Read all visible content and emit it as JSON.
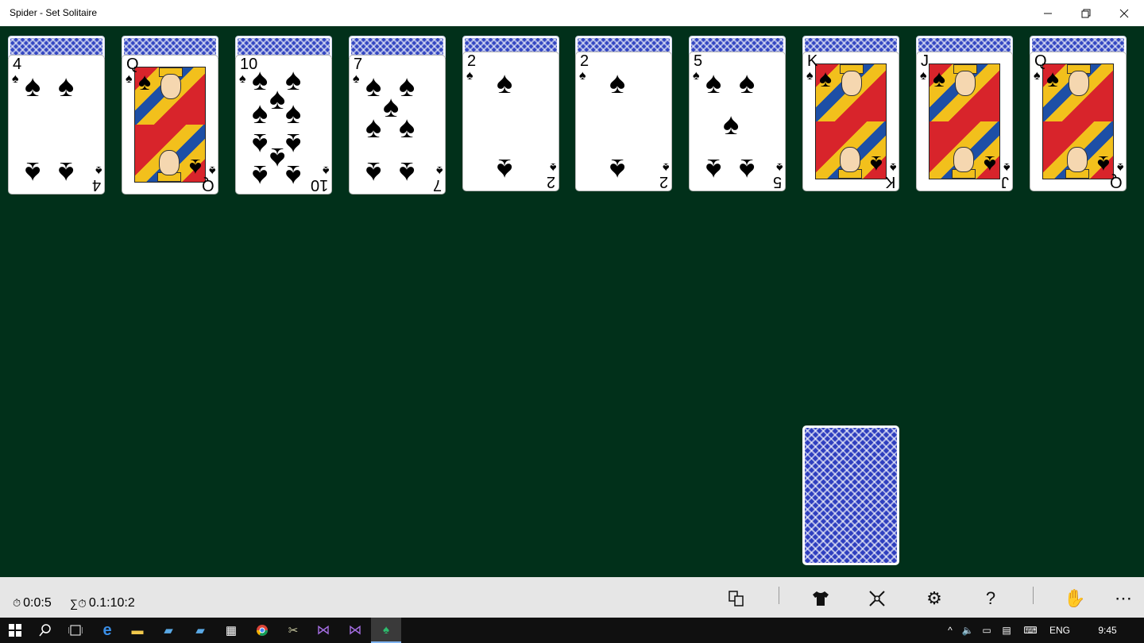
{
  "window": {
    "title": "Spider - Set Solitaire",
    "minimize_label": "—",
    "maximize_label": "❐",
    "close_label": "✕"
  },
  "piles": [
    {
      "rank": "4",
      "suit": "♠",
      "facedown": true
    },
    {
      "rank": "Q",
      "suit": "♠",
      "facedown": true
    },
    {
      "rank": "10",
      "suit": "♠",
      "facedown": true
    },
    {
      "rank": "7",
      "suit": "♠",
      "facedown": true
    },
    {
      "rank": "2",
      "suit": "♠",
      "facedown": true
    },
    {
      "rank": "2",
      "suit": "♠",
      "facedown": true
    },
    {
      "rank": "5",
      "suit": "♠",
      "facedown": true
    },
    {
      "rank": "K",
      "suit": "♠",
      "facedown": true
    },
    {
      "rank": "J",
      "suit": "♠",
      "facedown": true
    },
    {
      "rank": "Q",
      "suit": "♠",
      "facedown": true
    }
  ],
  "stock": {
    "label": "stock"
  },
  "appbar": {
    "game_time": "0:0:5",
    "total_time": "0.1:10:2",
    "timer_icon": "⏱",
    "sum_icon": "∑⏱",
    "buttons": [
      {
        "name": "hint-icon",
        "glyph": "⧉"
      },
      {
        "name": "card-back-shirt-icon",
        "glyph": "👕"
      },
      {
        "name": "new-game-icon",
        "glyph": "✲"
      },
      {
        "name": "settings-icon",
        "glyph": "⚙"
      },
      {
        "name": "help-icon",
        "glyph": "?"
      },
      {
        "name": "hand-icon",
        "glyph": "✋"
      },
      {
        "name": "more-icon",
        "glyph": "⋯"
      }
    ]
  },
  "taskbar": {
    "language": "ENG",
    "clock": "9:45"
  }
}
